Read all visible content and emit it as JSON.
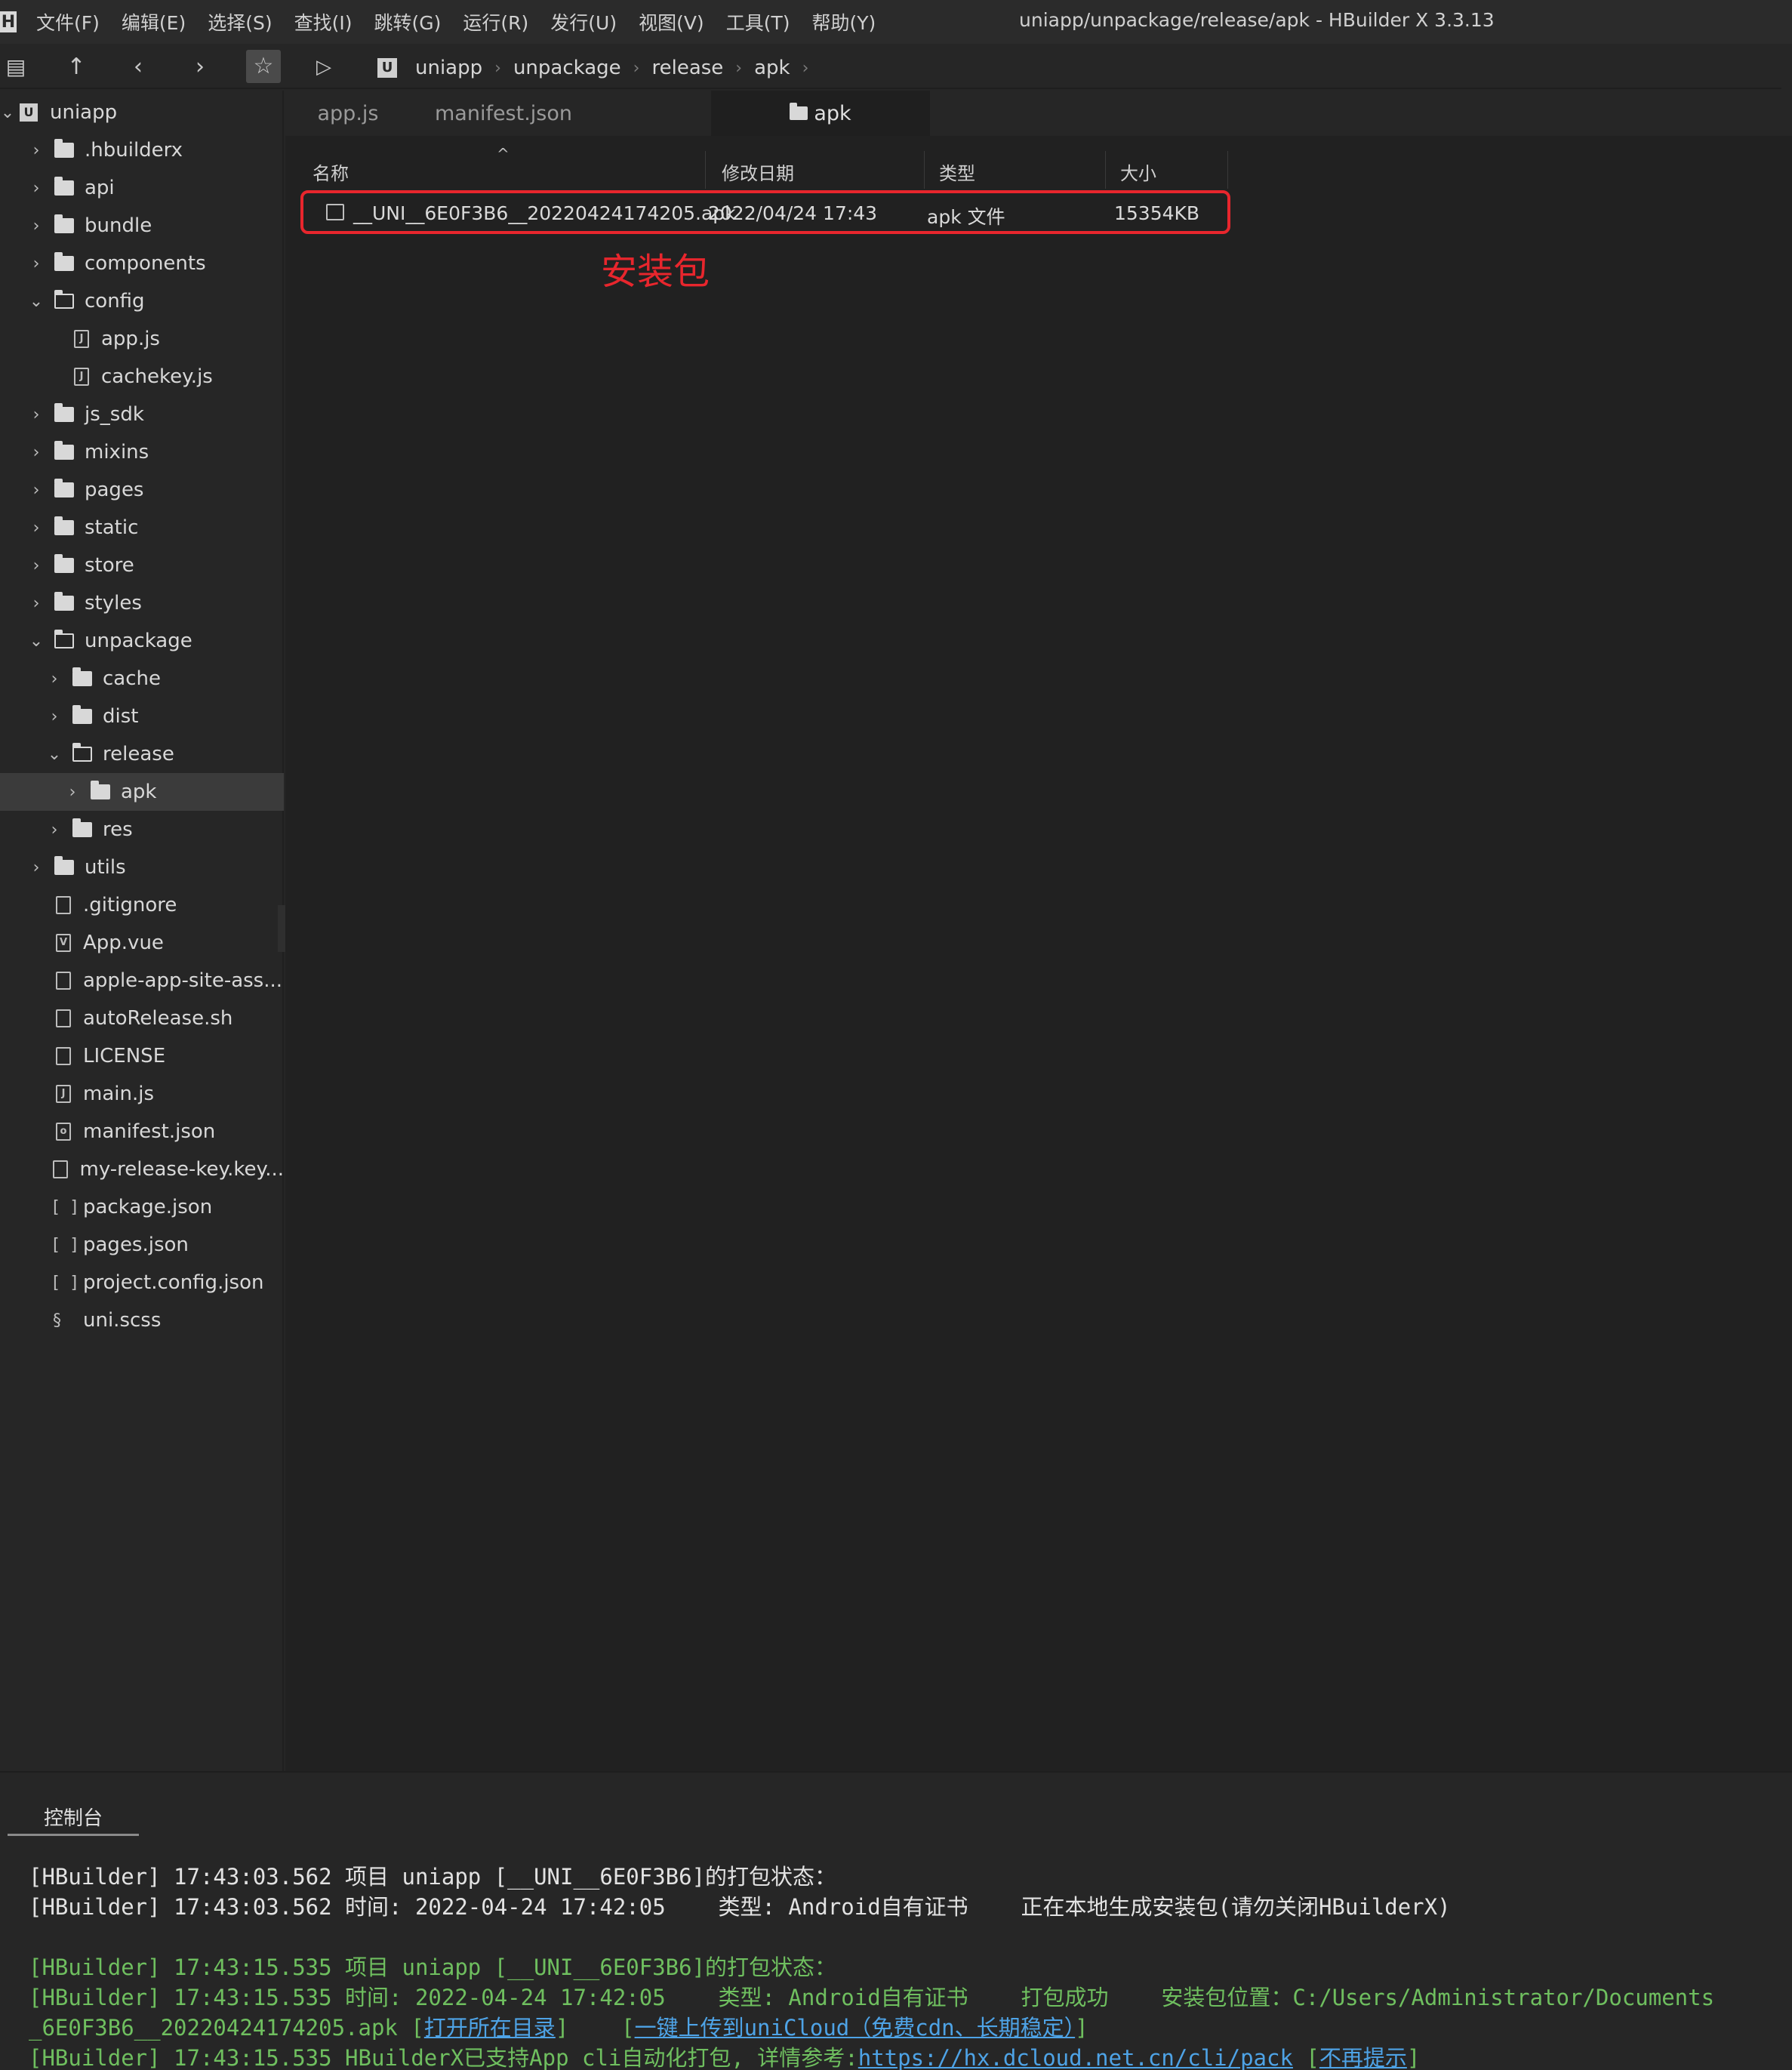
{
  "app": {
    "logo": "H",
    "menus": [
      "文件(F)",
      "编辑(E)",
      "选择(S)",
      "查找(I)",
      "跳转(G)",
      "运行(R)",
      "发行(U)",
      "视图(V)",
      "工具(T)",
      "帮助(Y)"
    ],
    "window_title": "uniapp/unpackage/release/apk - HBuilder X 3.3.13"
  },
  "toolbar": {
    "icons": [
      "new-file-icon",
      "up-arrow-icon",
      "back-icon",
      "forward-icon",
      "star-icon",
      "play-icon"
    ],
    "breadcrumb": [
      "uniapp",
      "unpackage",
      "release",
      "apk"
    ]
  },
  "sidebar": {
    "items": [
      {
        "label": "uniapp",
        "type": "project",
        "depth": 0,
        "expanded": true
      },
      {
        "label": ".hbuilderx",
        "type": "folder",
        "depth": 1,
        "expanded": false
      },
      {
        "label": "api",
        "type": "folder",
        "depth": 1,
        "expanded": false
      },
      {
        "label": "bundle",
        "type": "folder",
        "depth": 1,
        "expanded": false
      },
      {
        "label": "components",
        "type": "folder",
        "depth": 1,
        "expanded": false
      },
      {
        "label": "config",
        "type": "folder",
        "depth": 1,
        "expanded": true
      },
      {
        "label": "app.js",
        "type": "js",
        "depth": 2
      },
      {
        "label": "cachekey.js",
        "type": "js",
        "depth": 2
      },
      {
        "label": "js_sdk",
        "type": "folder",
        "depth": 1,
        "expanded": false
      },
      {
        "label": "mixins",
        "type": "folder",
        "depth": 1,
        "expanded": false
      },
      {
        "label": "pages",
        "type": "folder",
        "depth": 1,
        "expanded": false
      },
      {
        "label": "static",
        "type": "folder",
        "depth": 1,
        "expanded": false
      },
      {
        "label": "store",
        "type": "folder",
        "depth": 1,
        "expanded": false
      },
      {
        "label": "styles",
        "type": "folder",
        "depth": 1,
        "expanded": false
      },
      {
        "label": "unpackage",
        "type": "folder",
        "depth": 1,
        "expanded": true
      },
      {
        "label": "cache",
        "type": "folder",
        "depth": 2,
        "expanded": false
      },
      {
        "label": "dist",
        "type": "folder",
        "depth": 2,
        "expanded": false
      },
      {
        "label": "release",
        "type": "folder",
        "depth": 2,
        "expanded": true
      },
      {
        "label": "apk",
        "type": "folder",
        "depth": 3,
        "expanded": false,
        "selected": true
      },
      {
        "label": "res",
        "type": "folder",
        "depth": 2,
        "expanded": false
      },
      {
        "label": "utils",
        "type": "folder",
        "depth": 1,
        "expanded": false
      },
      {
        "label": ".gitignore",
        "type": "file",
        "depth": 1
      },
      {
        "label": "App.vue",
        "type": "vue",
        "depth": 1
      },
      {
        "label": "apple-app-site-ass...",
        "type": "file",
        "depth": 1
      },
      {
        "label": "autoRelease.sh",
        "type": "file",
        "depth": 1
      },
      {
        "label": "LICENSE",
        "type": "file",
        "depth": 1
      },
      {
        "label": "main.js",
        "type": "js",
        "depth": 1
      },
      {
        "label": "manifest.json",
        "type": "manifest",
        "depth": 1
      },
      {
        "label": "my-release-key.key...",
        "type": "file",
        "depth": 1
      },
      {
        "label": "package.json",
        "type": "json",
        "depth": 1
      },
      {
        "label": "pages.json",
        "type": "json",
        "depth": 1
      },
      {
        "label": "project.config.json",
        "type": "json",
        "depth": 1
      },
      {
        "label": "uni.scss",
        "type": "scss",
        "depth": 1
      }
    ]
  },
  "tabs": [
    {
      "label": "app.js",
      "active": false
    },
    {
      "label": "manifest.json",
      "active": false
    },
    {
      "label": "apk",
      "active": true
    }
  ],
  "explorer": {
    "columns": {
      "name": "名称",
      "modified": "修改日期",
      "type": "类型",
      "size": "大小"
    },
    "sort_indicator": "^",
    "files": [
      {
        "name": "__UNI__6E0F3B6__20220424174205.apk",
        "modified": "2022/04/24 17:43",
        "type": "apk 文件",
        "size": "15354KB"
      }
    ],
    "annotation": "安装包",
    "highlight_color": "#e8262d"
  },
  "console": {
    "tab_label": "控制台",
    "lines": [
      [
        {
          "t": "[HBuilder] 17:43:03.562 项目 uniapp [__UNI__6E0F3B6]的打包状态：",
          "c": "white"
        }
      ],
      [
        {
          "t": "[HBuilder] 17:43:03.562 时间: 2022-04-24 17:42:05    类型: Android自有证书    正在本地生成安装包(请勿关闭HBuilderX)",
          "c": "white"
        }
      ],
      [],
      [
        {
          "t": "[HBuilder] 17:43:15.535 项目 uniapp [__UNI__6E0F3B6]的打包状态：",
          "c": "green"
        }
      ],
      [
        {
          "t": "[HBuilder] 17:43:15.535 时间: 2022-04-24 17:42:05    类型: Android自有证书    打包成功    安装包位置：C:/Users/Administrator/Documents",
          "c": "green"
        }
      ],
      [
        {
          "t": "_6E0F3B6__20220424174205.apk [",
          "c": "green"
        },
        {
          "t": "打开所在目录",
          "c": "link"
        },
        {
          "t": "]    [",
          "c": "green"
        },
        {
          "t": "一键上传到uniCloud（免费cdn、长期稳定）",
          "c": "link"
        },
        {
          "t": "]",
          "c": "green"
        }
      ],
      [
        {
          "t": "[HBuilder] 17:43:15.535 HBuilderX已支持App cli自动化打包, 详情参考:",
          "c": "green"
        },
        {
          "t": "https://hx.dcloud.net.cn/cli/pack",
          "c": "link"
        },
        {
          "t": " [",
          "c": "green"
        },
        {
          "t": "不再提示",
          "c": "link"
        },
        {
          "t": "]",
          "c": "green"
        }
      ]
    ]
  }
}
